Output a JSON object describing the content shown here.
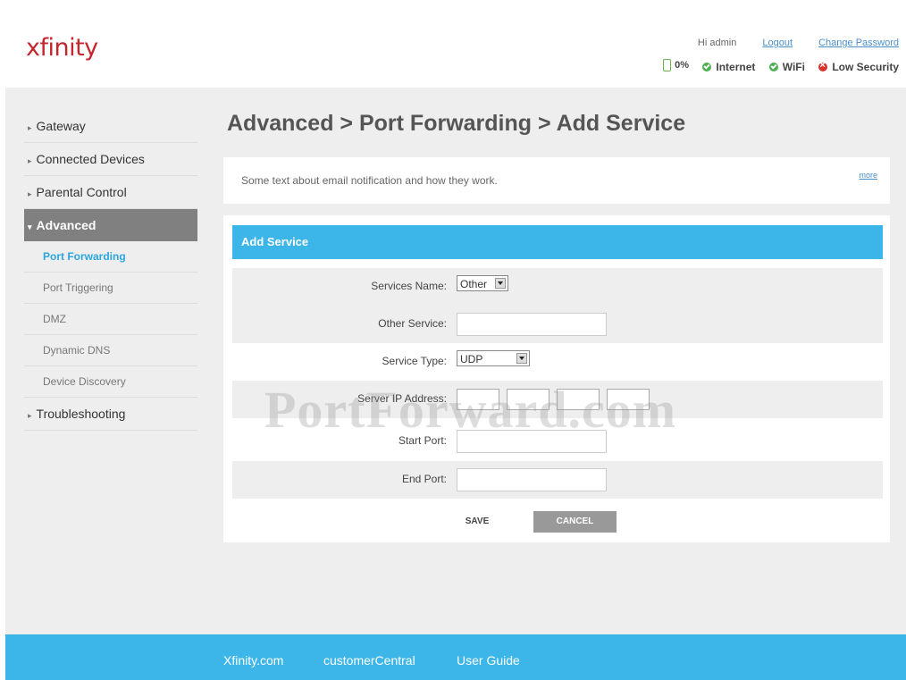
{
  "header": {
    "logo": "xfinity",
    "greeting": "Hi admin",
    "logout_label": "Logout",
    "change_password_label": "Change Password",
    "battery_label": "0%",
    "internet_label": "Internet",
    "wifi_label": "WiFi",
    "security_label": "Low Security"
  },
  "sidebar": {
    "items": [
      {
        "label": "Gateway"
      },
      {
        "label": "Connected Devices"
      },
      {
        "label": "Parental Control"
      },
      {
        "label": "Advanced"
      },
      {
        "label": "Troubleshooting"
      }
    ],
    "subitems": [
      {
        "label": "Port Forwarding"
      },
      {
        "label": "Port Triggering"
      },
      {
        "label": "DMZ"
      },
      {
        "label": "Dynamic DNS"
      },
      {
        "label": "Device Discovery"
      }
    ]
  },
  "main": {
    "title": "Advanced > Port Forwarding > Add Service",
    "info_text": "Some text about email notification and how they work.",
    "more_label": "more",
    "panel_title": "Add Service",
    "form": {
      "services_name_label": "Services Name:",
      "services_name_value": "Other",
      "other_service_label": "Other Service:",
      "service_type_label": "Service Type:",
      "service_type_value": "UDP",
      "server_ip_label": "Server IP Address:",
      "start_port_label": "Start Port:",
      "end_port_label": "End Port:"
    },
    "save_label": "SAVE",
    "cancel_label": "CANCEL"
  },
  "watermark": "PortForward.com",
  "footer": {
    "links": [
      "Xfinity.com",
      "customerCentral",
      "User Guide"
    ]
  },
  "colors": {
    "accent": "#3cb6e8",
    "brand": "#c4262e",
    "nav_active": "#808080",
    "ok": "#4caf50",
    "alert": "#d9342b"
  }
}
